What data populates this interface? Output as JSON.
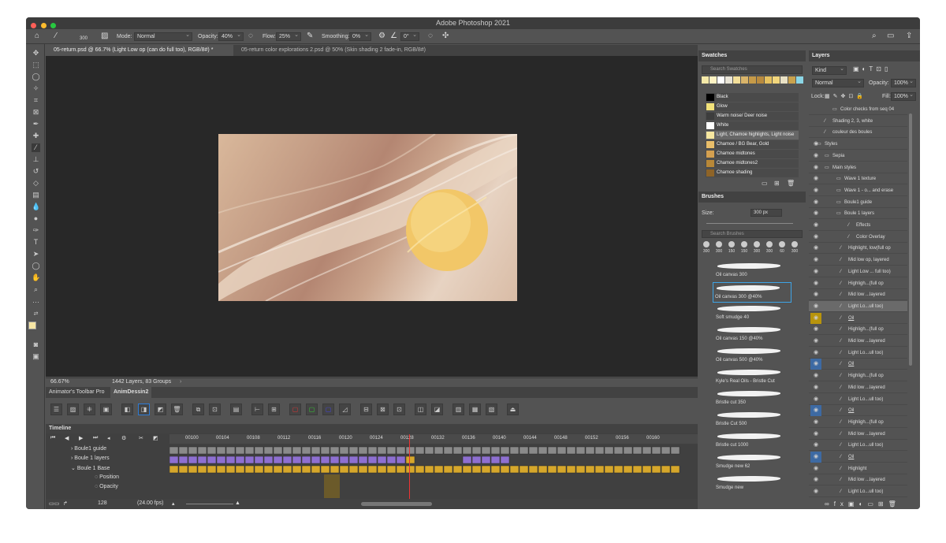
{
  "app_title": "Adobe Photoshop 2021",
  "options": {
    "brush_size": "300",
    "mode_label": "Mode:",
    "mode_value": "Normal",
    "opacity_label": "Opacity:",
    "opacity_value": "40%",
    "flow_label": "Flow:",
    "flow_value": "25%",
    "smoothing_label": "Smoothing:",
    "smoothing_value": "0%",
    "angle_value": "0°"
  },
  "doc_tabs": [
    {
      "label": "05-return.psd @ 66.7% (Light Low op (can do full too), RGB/8#) *"
    },
    {
      "label": "05-return color explorations 2.psd @ 50% (Skin shading 2 fade-in, RGB/8#)"
    }
  ],
  "status": {
    "zoom": "66.67%",
    "info": "1442 Layers, 83 Groups"
  },
  "anim_tabs": [
    "Animator's Toolbar Pro",
    "AnimDessin2"
  ],
  "timeline": {
    "title": "Timeline",
    "ruler": [
      "00100",
      "00104",
      "00108",
      "00112",
      "00116",
      "00120",
      "00124",
      "00128",
      "00132",
      "00136",
      "00140",
      "00144",
      "00148",
      "00152",
      "00156",
      "00160"
    ],
    "tracks": [
      "Boule1 guide",
      "Boule 1 layers",
      "Boule 1 Base",
      "Position",
      "Opacity"
    ],
    "frame": "128",
    "fps": "(24.00 fps)"
  },
  "swatches": {
    "title": "Swatches",
    "search_placeholder": "Search Swatches",
    "top_colors": [
      "#f5e9a8",
      "#fff3c4",
      "#ffffff",
      "#e8e4d6",
      "#f3df9a",
      "#d9b46a",
      "#c69a48",
      "#b88a3e",
      "#e6c15f",
      "#f2d67c",
      "#e9e1c5",
      "#c9a24d",
      "#8bd6e6"
    ],
    "items": [
      {
        "name": "Black",
        "color": "#000000"
      },
      {
        "name": "Glow",
        "color": "#f2e27a"
      },
      {
        "name": "Warm noise/ Deer noise",
        "color": "#3d3d3d"
      },
      {
        "name": "White",
        "color": "#ffffff"
      },
      {
        "name": "Light, Chamoe highlights, Light noise",
        "color": "#f7e7a0"
      },
      {
        "name": "Chamoe / BG Bear, Gold",
        "color": "#e9be6a"
      },
      {
        "name": "Chamoe midtones",
        "color": "#d4a050"
      },
      {
        "name": "Chamoe midtones2",
        "color": "#b88838"
      },
      {
        "name": "Chamoe shading",
        "color": "#8e6428"
      }
    ]
  },
  "brushes": {
    "title": "Brushes",
    "size_label": "Size:",
    "size_value": "300 px",
    "search_placeholder": "Search Brushes",
    "presets": [
      "300",
      "300",
      "150",
      "150",
      "300",
      "300",
      "60",
      "300"
    ],
    "items": [
      "Oil canvas 300",
      "Oil canvas 300 @40%",
      "Soft smudge 40",
      "Oil canvas 150 @40%",
      "Oil canvas 500 @40%",
      "Kyle's Real Oils - Bristle Cut",
      "Bristle cut 350",
      "Bristle Cut 500",
      "Bristle cut 1000",
      "Smudge new 62",
      "Smudge new"
    ]
  },
  "layers": {
    "title": "Layers",
    "kind": "Kind",
    "blend": "Normal",
    "opacity_label": "Opacity:",
    "opacity_value": "100%",
    "lock_label": "Lock:",
    "fill_label": "Fill:",
    "fill_value": "100%",
    "items": [
      "Color checks from seq 04",
      "Shading 2, 3, white",
      "couleur des boules",
      "Styles",
      "Sepia",
      "Main styles",
      "Wave 1 texture",
      "Wave 1 - o... and erase",
      "Boule1 guide",
      "Boule 1 layers",
      "Effects",
      "Color Overlay",
      "Highlight, low(full op",
      "Mid low op, layered",
      "Light Low ... full too)",
      "Highligh...(full op",
      "Mid low ...layered",
      "Light Lo...ull too)",
      "Oil",
      "Highligh...(full op",
      "Mid low ...layered",
      "Light Lo...ull too)",
      "Oil",
      "Highligh...(full op",
      "Mid low ...layered",
      "Light Lo...ull too)",
      "Oil",
      "Highligh...(full op",
      "Mid low ...layered",
      "Light Lo...ull too)",
      "Oil",
      "Highlight",
      "Mid low ...layered",
      "Light Lo...ull too)"
    ]
  }
}
